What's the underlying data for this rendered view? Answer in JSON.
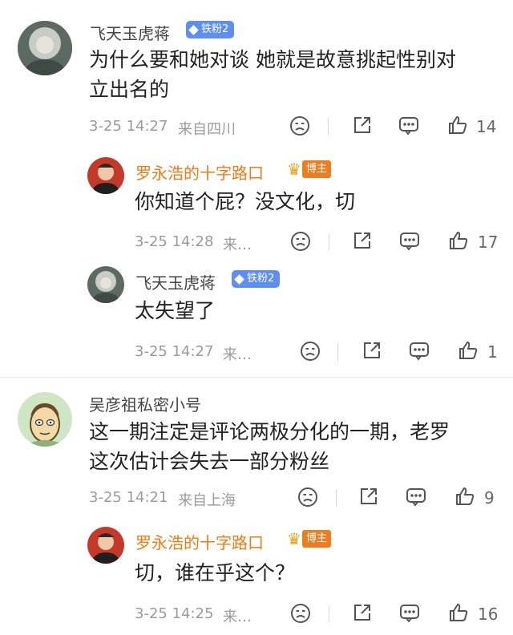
{
  "comments": [
    {
      "user": "飞天玉虎蒋",
      "badge": "铁粉2",
      "text_lines": [
        "为什么要和她对谈  她就是故意挑起性别对",
        "立出名的"
      ],
      "time": "3-25 14:27",
      "location": "来自四川",
      "likes": "14",
      "replies": [
        {
          "user": "罗永浩的十字路口",
          "badge": "博主",
          "text": "你知道个屁？没文化，切",
          "time": "3-25 14:28",
          "location": "来…",
          "likes": "17"
        },
        {
          "user": "飞天玉虎蒋",
          "badge": "铁粉2",
          "text": "太失望了",
          "time": "3-25 14:27",
          "location": "来…",
          "likes": "1"
        }
      ]
    },
    {
      "user": "吴彦祖私密小号",
      "text_lines": [
        "这一期注定是评论两极分化的一期，老罗",
        "这次估计会失去一部分粉丝"
      ],
      "time": "3-25 14:21",
      "location": "来自上海",
      "likes": "9",
      "replies": [
        {
          "user": "罗永浩的十字路口",
          "badge": "博主",
          "text": "切，谁在乎这个？",
          "time": "3-25 14:25",
          "location": "来…",
          "likes": "16"
        }
      ]
    }
  ],
  "colors": {
    "host_name": "#f07a14",
    "fan_badge": "#5d8ef0",
    "host_badge": "#ee7d20"
  }
}
